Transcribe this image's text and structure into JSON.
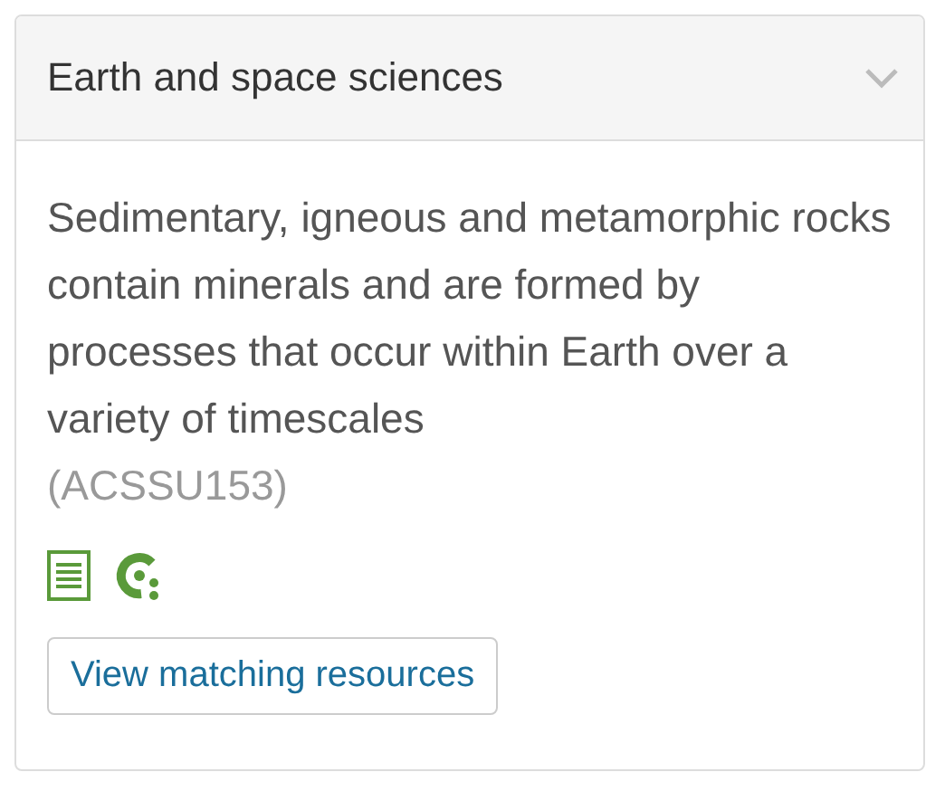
{
  "panel": {
    "title": "Earth and space sciences"
  },
  "description": "Sedimentary, igneous and metamorphic rocks contain minerals and are formed by processes that occur within Earth over a variety of timescales",
  "code": "(ACSSU153)",
  "button": "View matching resources"
}
